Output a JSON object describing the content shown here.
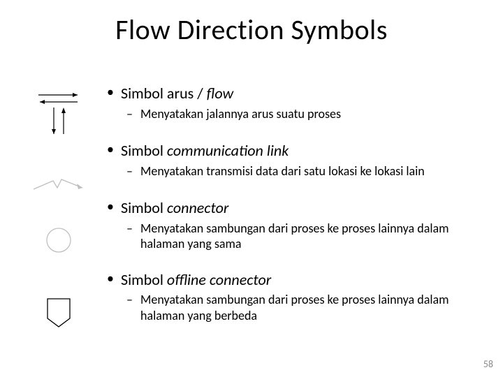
{
  "title": "Flow Direction Symbols",
  "page_number": "58",
  "items": [
    {
      "heading_prefix": "Simbol arus / ",
      "heading_italic": "flow",
      "sub": "Menyatakan jalannya arus suatu proses"
    },
    {
      "heading_prefix": "Simbol ",
      "heading_italic": "communication link",
      "sub": "Menyatakan transmisi data dari satu lokasi ke lokasi lain"
    },
    {
      "heading_prefix": "Simbol ",
      "heading_italic": "connector",
      "sub": "Menyatakan sambungan dari proses ke proses lainnya dalam halaman yang sama"
    },
    {
      "heading_prefix": "Simbol ",
      "heading_italic": "offline connector",
      "sub": "Menyatakan sambungan dari proses ke proses lainnya dalam halaman yang berbeda"
    }
  ]
}
